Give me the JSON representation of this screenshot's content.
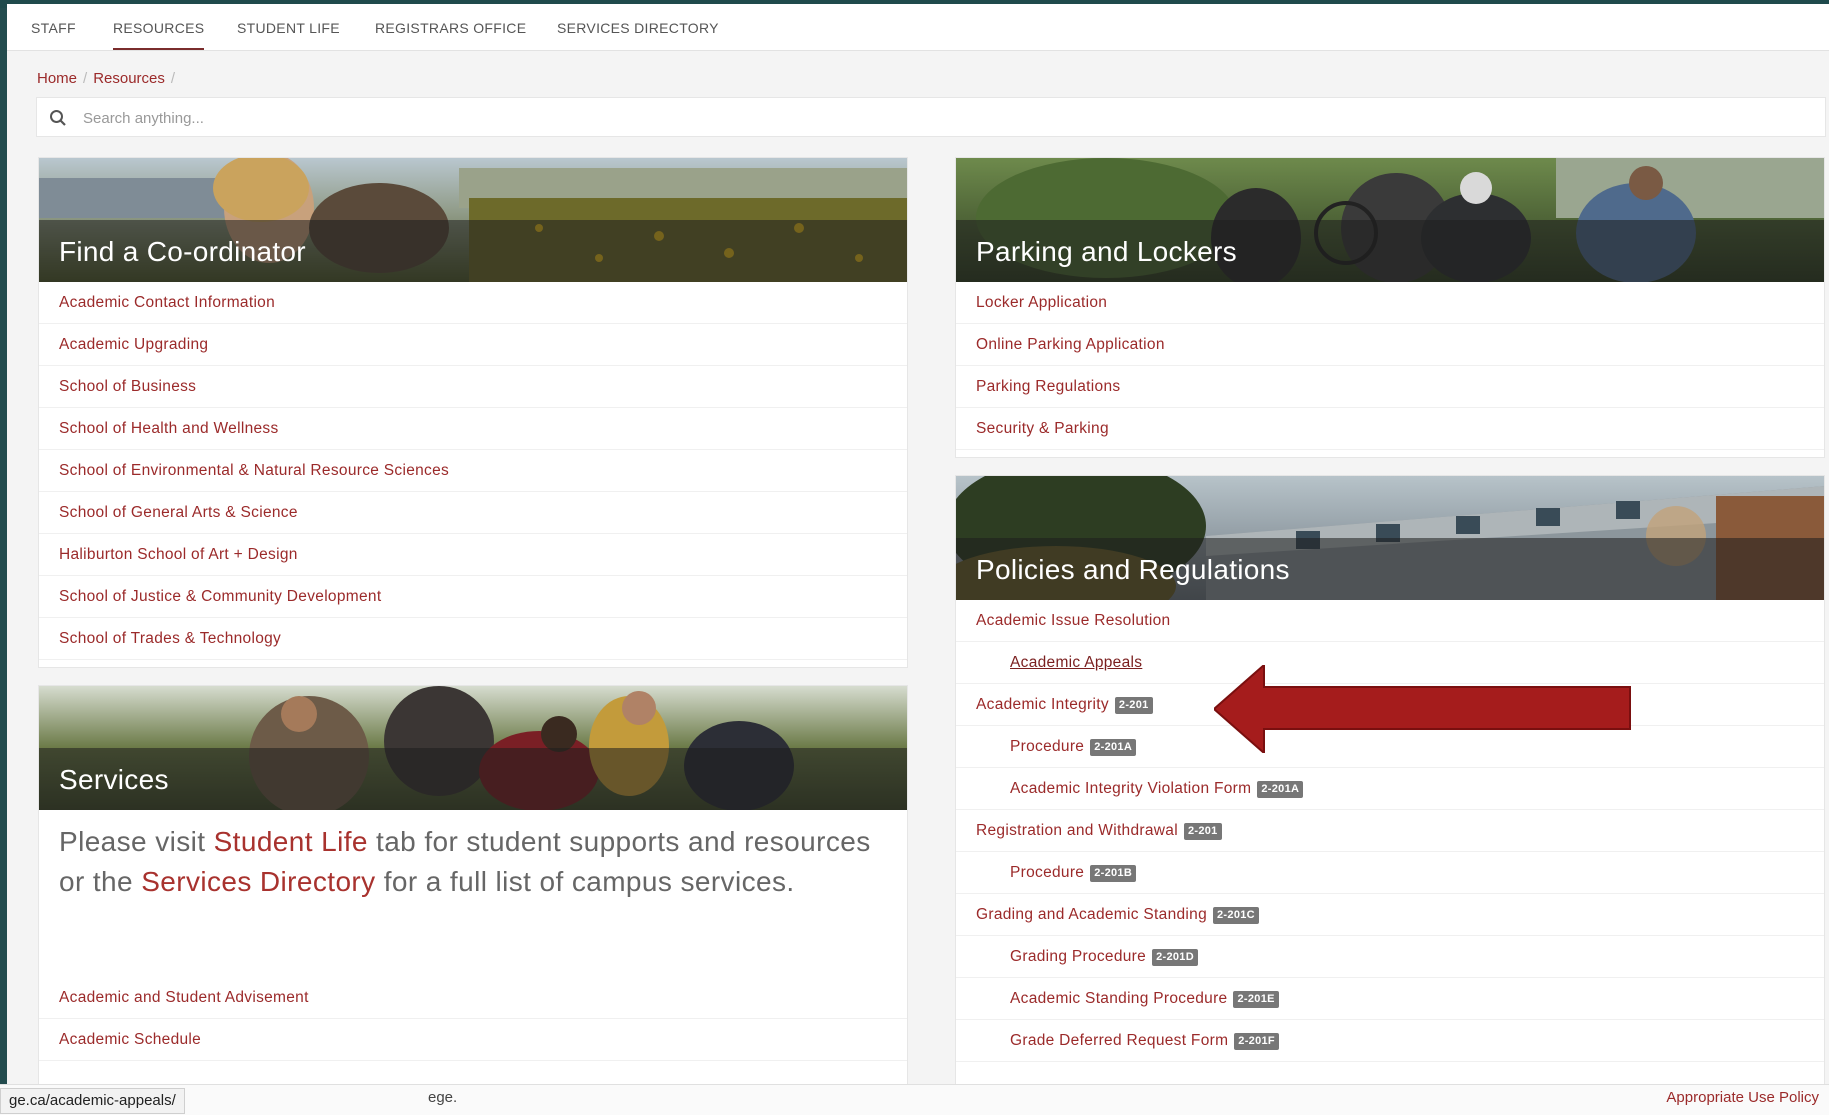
{
  "nav": {
    "items": [
      "STAFF",
      "RESOURCES",
      "STUDENT LIFE",
      "REGISTRARS OFFICE",
      "SERVICES DIRECTORY"
    ],
    "active": "RESOURCES"
  },
  "breadcrumb": {
    "home": "Home",
    "current": "Resources",
    "sep": "/"
  },
  "search": {
    "placeholder": "Search anything..."
  },
  "cards": {
    "coordinator": {
      "title": "Find a Co-ordinator",
      "links": [
        "Academic Contact Information",
        "Academic Upgrading",
        "School of Business",
        "School of Health and Wellness",
        "School of Environmental & Natural Resource Sciences",
        "School of General Arts & Science",
        "Haliburton School of Art + Design",
        "School of Justice & Community Development",
        "School of Trades & Technology"
      ]
    },
    "parking": {
      "title": "Parking and Lockers",
      "links": [
        "Locker Application",
        "Online Parking Application",
        "Parking Regulations",
        "Security & Parking"
      ]
    },
    "policies": {
      "title": "Policies and Regulations",
      "links": [
        {
          "label": "Academic Issue Resolution",
          "badge": ""
        },
        {
          "label": "Academic Appeals",
          "badge": ""
        },
        {
          "label": "Academic Integrity",
          "badge": "2-201"
        },
        {
          "label": "Procedure",
          "badge": "2-201A"
        },
        {
          "label": "Academic Integrity Violation Form",
          "badge": "2-201A"
        },
        {
          "label": "Registration and Withdrawal",
          "badge": "2-201"
        },
        {
          "label": "Procedure",
          "badge": "2-201B"
        },
        {
          "label": "Grading and Academic Standing",
          "badge": "2-201C"
        },
        {
          "label": "Grading Procedure",
          "badge": "2-201D"
        },
        {
          "label": "Academic Standing Procedure",
          "badge": "2-201E"
        },
        {
          "label": "Grade Deferred Request Form",
          "badge": "2-201F"
        }
      ]
    },
    "services": {
      "title": "Services",
      "text_before": "Please visit ",
      "student_life_link": "Student Life",
      "text_middle": " tab for student supports and resources or the ",
      "services_dir_link": "Services Directory",
      "text_after": " for a full list of campus services.",
      "links": [
        "Academic and Student Advisement",
        "Academic Schedule"
      ]
    }
  },
  "status_bar": {
    "url": "ge.ca/academic-appeals/",
    "footer_fragment": "ege.",
    "footer_right": "Appropriate Use Policy"
  },
  "colors": {
    "link": "#9b2a2a",
    "arrow": "#a51c1c",
    "badge": "#777777"
  }
}
